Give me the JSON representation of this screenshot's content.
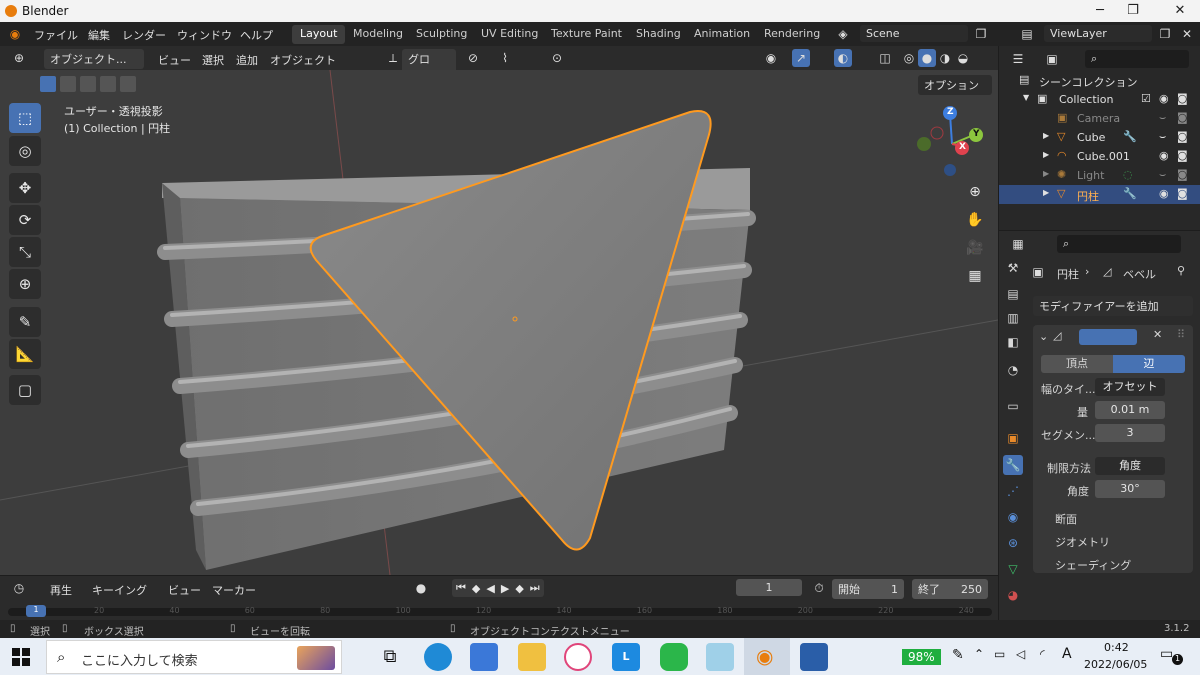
{
  "window": {
    "title": "Blender",
    "minimize": "─",
    "maximize": "❐",
    "close": "✕"
  },
  "menu": [
    "ファイル",
    "編集",
    "レンダー",
    "ウィンドウ",
    "ヘルプ"
  ],
  "workspaces": [
    "Layout",
    "Modeling",
    "Sculpting",
    "UV Editing",
    "Texture Paint",
    "Shading",
    "Animation",
    "Rendering"
  ],
  "scene": "Scene",
  "view_layer": "ViewLayer",
  "viewport_header": {
    "mode": "オブジェクト...",
    "view": "ビュー",
    "select": "選択",
    "add": "追加",
    "object": "オブジェクト",
    "transform": "グロー..."
  },
  "viewport": {
    "view_name": "ユーザー・透視投影",
    "collection": "(1) Collection | 円柱",
    "options": "オプション"
  },
  "gizmo": {
    "z": "Z",
    "y": "Y",
    "x": "X"
  },
  "outliner": {
    "root": "シーンコレクション",
    "items": [
      {
        "name": "Collection"
      },
      {
        "name": "Camera"
      },
      {
        "name": "Cube"
      },
      {
        "name": "Cube.001"
      },
      {
        "name": "Light"
      },
      {
        "name": "円柱"
      }
    ]
  },
  "properties": {
    "object": "円柱",
    "modifier": "ベベル",
    "add_modifier": "モディファイアーを追加",
    "tabs": {
      "vertex": "頂点",
      "edge": "辺"
    },
    "width_type_label": "幅のタイ...",
    "width_type": "オフセット",
    "amount_label": "量",
    "amount": "0.01 m",
    "segments_label": "セグメン...",
    "segments": "3",
    "limit_label": "制限方法",
    "limit": "角度",
    "angle_label": "角度",
    "angle": "30°",
    "sections": [
      "断面",
      "ジオメトリ",
      "シェーディング"
    ]
  },
  "timeline": {
    "playback": "再生",
    "keying": "キーイング",
    "view": "ビュー",
    "marker": "マーカー",
    "frame": "1",
    "start_label": "開始",
    "start": "1",
    "end_label": "終了",
    "end": "250",
    "current": "1",
    "ticks": [
      "20",
      "40",
      "60",
      "80",
      "100",
      "120",
      "140",
      "160",
      "180",
      "200",
      "220",
      "240"
    ]
  },
  "status": {
    "select": "選択",
    "box": "ボックス選択",
    "rotate": "ビューを回転",
    "context": "オブジェクトコンテクストメニュー",
    "version": "3.1.2"
  },
  "taskbar": {
    "search": "ここに入力して検索",
    "battery": "98%",
    "ime": "A",
    "time": "0:42",
    "date": "2022/06/05",
    "notif": "1"
  }
}
